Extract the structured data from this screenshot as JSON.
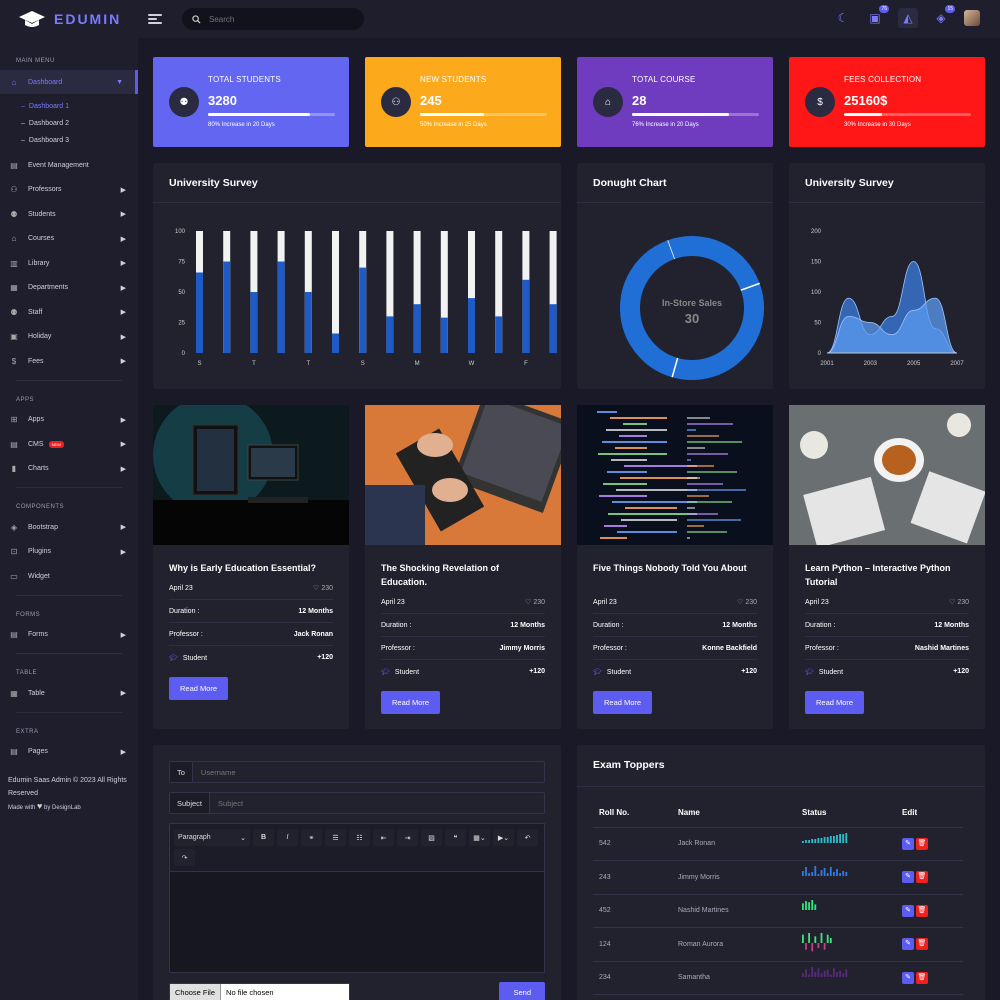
{
  "topbar": {
    "brand": "EDUMIN",
    "search_placeholder": "Search",
    "icons": [
      {
        "name": "moon-icon",
        "badge": ""
      },
      {
        "name": "chat-icon",
        "badge": "76"
      },
      {
        "name": "bell-icon",
        "badge": ""
      },
      {
        "name": "cube-icon",
        "badge": "15"
      }
    ]
  },
  "sidebar": {
    "main_menu_title": "MAIN MENU",
    "dashboard": "Dashboard",
    "dashboard_subs": [
      "Dashboard 1",
      "Dashboard 2",
      "Dashboard 3"
    ],
    "main_items": [
      {
        "label": "Event Management",
        "icon": "▤",
        "arrow": false
      },
      {
        "label": "Professors",
        "icon": "⚇",
        "arrow": true
      },
      {
        "label": "Students",
        "icon": "⚉",
        "arrow": true
      },
      {
        "label": "Courses",
        "icon": "⌂",
        "arrow": true
      },
      {
        "label": "Library",
        "icon": "▥",
        "arrow": true
      },
      {
        "label": "Departments",
        "icon": "▦",
        "arrow": true
      },
      {
        "label": "Staff",
        "icon": "⚉",
        "arrow": true
      },
      {
        "label": "Holiday",
        "icon": "▣",
        "arrow": true
      },
      {
        "label": "Fees",
        "icon": "$",
        "arrow": true
      }
    ],
    "apps_title": "APPS",
    "apps_items": [
      {
        "label": "Apps",
        "icon": "⊞",
        "arrow": true
      },
      {
        "label": "CMS",
        "icon": "▤",
        "arrow": true,
        "badge": "NEW"
      },
      {
        "label": "Charts",
        "icon": "▮",
        "arrow": true
      }
    ],
    "components_title": "COMPONENTS",
    "components_items": [
      {
        "label": "Bootstrap",
        "icon": "◈",
        "arrow": true
      },
      {
        "label": "Plugins",
        "icon": "⊡",
        "arrow": true
      },
      {
        "label": "Widget",
        "icon": "▭",
        "arrow": false
      }
    ],
    "forms_title": "FORMS",
    "forms_items": [
      {
        "label": "Forms",
        "icon": "▤",
        "arrow": true
      }
    ],
    "table_title": "TABLE",
    "table_items": [
      {
        "label": "Table",
        "icon": "▦",
        "arrow": true
      }
    ],
    "extra_title": "EXTRA",
    "extra_items": [
      {
        "label": "Pages",
        "icon": "▤",
        "arrow": true
      }
    ],
    "footer_line1": "Edumin Saas Admin © 2023 All Rights Reserved",
    "footer_made": "Made with",
    "footer_by": "by DesignLab"
  },
  "stats": [
    {
      "label": "TOTAL STUDENTS",
      "value": "3280",
      "note": "80% Increase in 20 Days",
      "progress": 0.8,
      "color": "#6366f1",
      "icon": "⚉"
    },
    {
      "label": "NEW STUDENTS",
      "value": "245",
      "note": "50% Increase in 25 Days",
      "progress": 0.5,
      "color": "#fca91c",
      "icon": "⚇"
    },
    {
      "label": "TOTAL COURSE",
      "value": "28",
      "note": "76% Increase in 20 Days",
      "progress": 0.76,
      "color": "#6f3bbf",
      "icon": "⌂"
    },
    {
      "label": "FEES COLLECTION",
      "value": "25160$",
      "note": "30% Increase in 30 Days",
      "progress": 0.3,
      "color": "#ff1717",
      "icon": "$"
    }
  ],
  "survey_card": {
    "title": "University Survey"
  },
  "donut_card": {
    "title": "Donught Chart"
  },
  "area_card": {
    "title": "University Survey"
  },
  "chart_data": [
    {
      "type": "bar",
      "categories": [
        "S",
        "",
        "T",
        "",
        "T",
        "",
        "S",
        "",
        "M",
        "",
        "W",
        "",
        "F",
        ""
      ],
      "series": [
        {
          "values": [
            66,
            75,
            50,
            75,
            50,
            16,
            70,
            30,
            40,
            29,
            45,
            30,
            60,
            40
          ],
          "color": "#1f5bc6"
        },
        {
          "values": [
            100,
            100,
            100,
            100,
            100,
            100,
            100,
            100,
            100,
            100,
            100,
            100,
            100,
            100
          ],
          "color": "#f2f2f2"
        }
      ],
      "ylim": [
        0,
        100
      ],
      "yticks": [
        0,
        25,
        50,
        75,
        100
      ]
    },
    {
      "type": "pie",
      "center_label": "In-Store Sales",
      "center_value": "30",
      "slices": [
        25,
        35,
        40
      ],
      "color": "#1f6fd6"
    },
    {
      "type": "area",
      "xticks": [
        "2001",
        "2003",
        "2005",
        "2007"
      ],
      "ylim": [
        0,
        200
      ],
      "yticks": [
        0,
        50,
        100,
        150,
        200
      ],
      "series": [
        {
          "x": [
            2001,
            2002,
            2003,
            2004,
            2005,
            2006,
            2007
          ],
          "values": [
            0,
            90,
            30,
            60,
            150,
            40,
            0
          ],
          "color": "#3b7de0"
        },
        {
          "x": [
            2001,
            2002,
            2003,
            2004,
            2005,
            2006,
            2007
          ],
          "values": [
            0,
            60,
            50,
            30,
            70,
            90,
            0
          ],
          "color": "#5b9cf2"
        }
      ]
    }
  ],
  "courses": [
    {
      "title": "Why is Early Education Essential?",
      "date": "April 23",
      "likes": "230",
      "duration_label": "Duration :",
      "duration": "12 Months",
      "prof_label": "Professor :",
      "professor": "Jack Ronan",
      "student_label": "Student",
      "students": "+120",
      "btn": "Read More",
      "img": "monitors"
    },
    {
      "title": "The Shocking Revelation of Education.",
      "date": "April 23",
      "likes": "230",
      "duration_label": "Duration :",
      "duration": "12 Months",
      "prof_label": "Professor :",
      "professor": "Jimmy Morris",
      "student_label": "Student",
      "students": "+120",
      "btn": "Read More",
      "img": "keyboard"
    },
    {
      "title": "Five Things Nobody Told You About",
      "date": "April 23",
      "likes": "230",
      "duration_label": "Duration :",
      "duration": "12 Months",
      "prof_label": "Professor :",
      "professor": "Konne Backfield",
      "student_label": "Student",
      "students": "+120",
      "btn": "Read More",
      "img": "code"
    },
    {
      "title": "Learn Python – Interactive Python Tutorial",
      "date": "April 23",
      "likes": "230",
      "duration_label": "Duration :",
      "duration": "12 Months",
      "prof_label": "Professor :",
      "professor": "Nashid Martines",
      "student_label": "Student",
      "students": "+120",
      "btn": "Read More",
      "img": "tea"
    }
  ],
  "mail": {
    "to_label": "To",
    "to_placeholder": "Username",
    "subject_label": "Subject",
    "subject_placeholder": "Subject",
    "paragraph": "Paragraph",
    "choose_file": "Choose File",
    "no_file": "No file chosen",
    "send": "Send"
  },
  "toppers": {
    "title": "Exam Toppers",
    "headers": [
      "Roll No.",
      "Name",
      "Status",
      "Edit"
    ],
    "rows": [
      {
        "roll": "542",
        "name": "Jack Ronan",
        "spark": [
          2,
          3,
          3,
          4,
          4,
          5,
          5,
          6,
          6,
          7,
          7,
          8,
          9,
          9,
          10
        ],
        "color": "#2bbfd0"
      },
      {
        "roll": "243",
        "name": "Jimmy Morris",
        "spark": [
          5,
          9,
          3,
          4,
          10,
          2,
          6,
          8,
          3,
          9,
          4,
          7,
          3,
          5,
          4
        ],
        "color": "#2f7be8"
      },
      {
        "roll": "452",
        "name": "Nashid Martines",
        "spark": [
          6,
          8,
          7,
          9,
          5
        ],
        "color": "#2ee87a"
      },
      {
        "roll": "124",
        "name": "Roman Aurora",
        "spark": [
          5,
          -4,
          6,
          -5,
          4,
          -3,
          6,
          -4,
          5,
          3
        ],
        "color": "#3ee67a"
      },
      {
        "roll": "234",
        "name": "Samantha",
        "spark": [
          3,
          6,
          2,
          8,
          4,
          7,
          3,
          5,
          6,
          2,
          7,
          4,
          5,
          3,
          6
        ],
        "color": "#5b2a7a"
      }
    ]
  }
}
